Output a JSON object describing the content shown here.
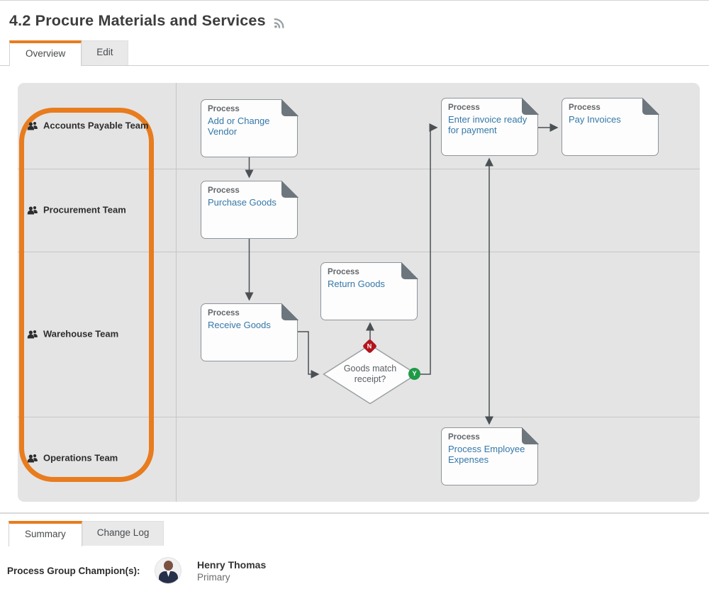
{
  "header": {
    "title": "4.2 Procure Materials and Services"
  },
  "top_tabs": {
    "overview": "Overview",
    "edit": "Edit"
  },
  "diagram": {
    "lanes": [
      {
        "label": "Accounts Payable Team"
      },
      {
        "label": "Procurement Team"
      },
      {
        "label": "Warehouse Team"
      },
      {
        "label": "Operations Team"
      }
    ],
    "nodes": [
      {
        "type_label": "Process",
        "title": "Add or Change Vendor"
      },
      {
        "type_label": "Process",
        "title": "Enter invoice ready for payment"
      },
      {
        "type_label": "Process",
        "title": "Pay Invoices"
      },
      {
        "type_label": "Process",
        "title": "Purchase Goods"
      },
      {
        "type_label": "Process",
        "title": "Return Goods"
      },
      {
        "type_label": "Process",
        "title": "Receive Goods"
      },
      {
        "type_label": "Process",
        "title": "Process Employee Expenses"
      }
    ],
    "decision": {
      "label": "Goods match receipt?",
      "no_label": "N",
      "yes_label": "Y"
    }
  },
  "bottom_tabs": {
    "summary": "Summary",
    "change_log": "Change Log"
  },
  "summary_panel": {
    "champion_label": "Process Group Champion(s):",
    "champion_name": "Henry Thomas",
    "champion_role": "Primary"
  },
  "colors": {
    "accent_orange": "#E87C1E",
    "node_link_blue": "#3578A9",
    "decision_no_red": "#B3131D",
    "decision_yes_green": "#1F9B47",
    "lane_background": "#E4E4E4"
  }
}
